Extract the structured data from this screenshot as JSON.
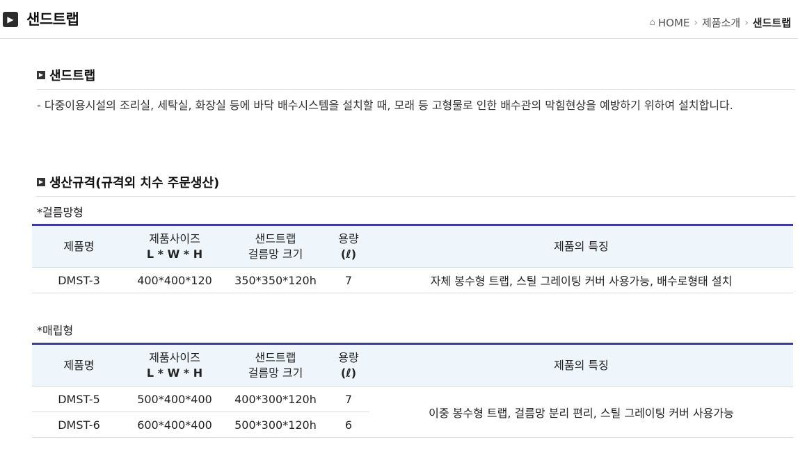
{
  "header": {
    "title": "샌드트랩",
    "breadcrumb": {
      "home": "HOME",
      "category": "제품소개",
      "current": "샌드트랩"
    }
  },
  "intro": {
    "heading": "샌드트랩",
    "description": "- 다중이용시설의 조리실, 세탁실, 화장실 등에 바닥 배수시스템을 설치할 때, 모래 등 고형물로 인한 배수관의 막힘현상을 예방하기 위하여 설치합니다."
  },
  "spec_section": {
    "heading": "생산규격(규격외 치수 주문생산)"
  },
  "table_headers": {
    "name": "제품명",
    "size_line1": "제품사이즈",
    "size_line2": "L * W * H",
    "trap_line1": "샌드트랩",
    "trap_line2": "걸름망 크기",
    "vol_line1": "용량",
    "vol_line2": "(ℓ)",
    "feature": "제품의 특징"
  },
  "tables": [
    {
      "subtitle": "*걸름망형",
      "rows": [
        {
          "name": "DMST-3",
          "size": "400*400*120",
          "trap": "350*350*120h",
          "volume": "7",
          "feature": "자체 봉수형 트랩, 스틸 그레이팅 커버 사용가능, 배수로형태 설치"
        }
      ]
    },
    {
      "subtitle": "*매립형",
      "rows": [
        {
          "name": "DMST-5",
          "size": "500*400*400",
          "trap": "400*300*120h",
          "volume": "7"
        },
        {
          "name": "DMST-6",
          "size": "600*400*400",
          "trap": "500*300*120h",
          "volume": "6"
        }
      ],
      "feature": "이중 봉수형 트랩, 걸름망 분리 편리, 스틸 그레이팅 커버 사용가능"
    }
  ],
  "icons": {
    "title": "play-arrow-icon",
    "home": "home-icon",
    "section": "bullet-arrow-icon"
  },
  "colors": {
    "table_top_border": "#3a3aa0",
    "header_bg": "#eef6fb"
  }
}
